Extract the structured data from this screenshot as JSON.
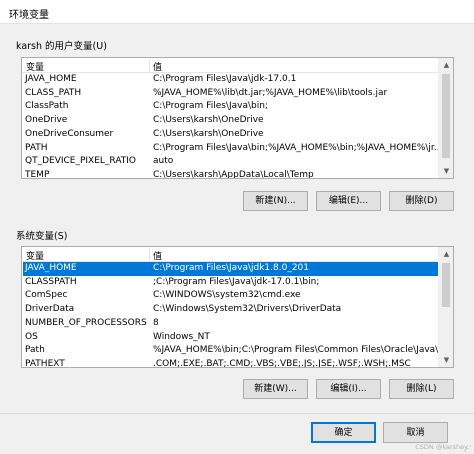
{
  "window": {
    "title": "环境变量"
  },
  "user_vars": {
    "group_label": "karsh 的用户变量(U)",
    "columns": [
      "变量",
      "值"
    ],
    "rows": [
      {
        "name": "JAVA_HOME",
        "value": "C:\\Program Files\\Java\\jdk-17.0.1"
      },
      {
        "name": "CLASS_PATH",
        "value": "%JAVA_HOME%\\lib\\dt.jar;%JAVA_HOME%\\lib\\tools.jar"
      },
      {
        "name": "ClassPath",
        "value": "C:\\Program Files\\Java\\bin;"
      },
      {
        "name": "OneDrive",
        "value": "C:\\Users\\karsh\\OneDrive"
      },
      {
        "name": "OneDriveConsumer",
        "value": "C:\\Users\\karsh\\OneDrive"
      },
      {
        "name": "PATH",
        "value": "C:\\Program Files\\Java\\bin;%JAVA_HOME%\\bin;%JAVA_HOME%\\jr..."
      },
      {
        "name": "QT_DEVICE_PIXEL_RATIO",
        "value": "auto"
      },
      {
        "name": "TEMP",
        "value": "C:\\Users\\karsh\\AppData\\Local\\Temp"
      }
    ],
    "buttons": {
      "new": "新建(N)...",
      "edit": "编辑(E)...",
      "delete": "删除(D)"
    }
  },
  "system_vars": {
    "group_label": "系统变量(S)",
    "columns": [
      "变量",
      "值"
    ],
    "rows": [
      {
        "name": "JAVA_HOME",
        "value": "C:\\Program Files\\Java\\jdk1.8.0_201"
      },
      {
        "name": "CLASSPATH",
        "value": ";C:\\Program Files\\Java\\jdk-17.0.1\\bin;"
      },
      {
        "name": "ComSpec",
        "value": "C:\\WINDOWS\\system32\\cmd.exe"
      },
      {
        "name": "DriverData",
        "value": "C:\\Windows\\System32\\Drivers\\DriverData"
      },
      {
        "name": "NUMBER_OF_PROCESSORS",
        "value": "8"
      },
      {
        "name": "OS",
        "value": "Windows_NT"
      },
      {
        "name": "Path",
        "value": "%JAVA_HOME%\\bin;C:\\Program Files\\Common Files\\Oracle\\Java\\j..."
      },
      {
        "name": "PATHEXT",
        "value": ".COM;.EXE;.BAT;.CMD;.VBS;.VBE;.JS;.JSE;.WSF;.WSH;.MSC"
      }
    ],
    "selected_row": 0,
    "buttons": {
      "new": "新建(W)...",
      "edit": "编辑(I)...",
      "delete": "删除(L)"
    }
  },
  "footer": {
    "ok": "确定",
    "cancel": "取消",
    "watermark": "CSDN @karshey"
  },
  "colors": {
    "selection": "#0078d7",
    "button": "#e1e1e1",
    "border": "#adadad"
  }
}
